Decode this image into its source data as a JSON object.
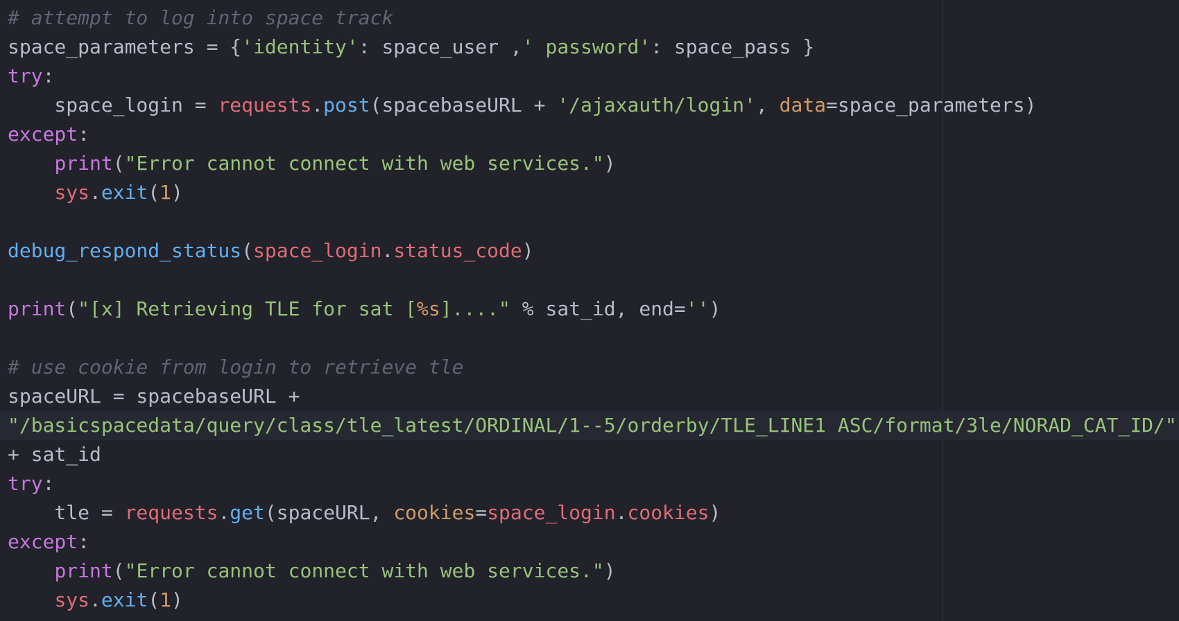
{
  "editor": {
    "theme_colors": {
      "background": "#21222a",
      "comment": "#5f6573",
      "plain": "#b6bdc8",
      "string": "#98c379",
      "keyword": "#c678dd",
      "variable_red": "#e06c75",
      "function_blue": "#61afef",
      "number_orange": "#d19a66"
    },
    "lines": [
      [
        {
          "t": "comment",
          "v": "# attempt to log into space track"
        }
      ],
      [
        {
          "t": "plain",
          "v": "space_parameters = {"
        },
        {
          "t": "string",
          "v": "'identity'"
        },
        {
          "t": "plain",
          "v": ": space_user ,"
        },
        {
          "t": "string",
          "v": "' password'"
        },
        {
          "t": "plain",
          "v": ": space_pass }"
        }
      ],
      [
        {
          "t": "keyword",
          "v": "try"
        },
        {
          "t": "plain",
          "v": ":"
        }
      ],
      [
        {
          "t": "plain",
          "v": "    space_login = "
        },
        {
          "t": "red",
          "v": "requests"
        },
        {
          "t": "plain",
          "v": "."
        },
        {
          "t": "fn",
          "v": "post"
        },
        {
          "t": "plain",
          "v": "(spacebaseURL + "
        },
        {
          "t": "string",
          "v": "'/ajaxauth/login'"
        },
        {
          "t": "plain",
          "v": ", "
        },
        {
          "t": "orange",
          "v": "data"
        },
        {
          "t": "plain",
          "v": "=space_parameters)"
        }
      ],
      [
        {
          "t": "keyword",
          "v": "except"
        },
        {
          "t": "plain",
          "v": ":"
        }
      ],
      [
        {
          "t": "plain",
          "v": "    "
        },
        {
          "t": "keyword",
          "v": "print"
        },
        {
          "t": "plain",
          "v": "("
        },
        {
          "t": "string",
          "v": "\"Error cannot connect with web services.\""
        },
        {
          "t": "plain",
          "v": ")"
        }
      ],
      [
        {
          "t": "plain",
          "v": "    "
        },
        {
          "t": "red",
          "v": "sys"
        },
        {
          "t": "plain",
          "v": "."
        },
        {
          "t": "fn",
          "v": "exit"
        },
        {
          "t": "plain",
          "v": "("
        },
        {
          "t": "orange",
          "v": "1"
        },
        {
          "t": "plain",
          "v": ")"
        }
      ],
      [],
      [
        {
          "t": "fn",
          "v": "debug_respond_status"
        },
        {
          "t": "plain",
          "v": "("
        },
        {
          "t": "red",
          "v": "space_login"
        },
        {
          "t": "plain",
          "v": "."
        },
        {
          "t": "red",
          "v": "status_code"
        },
        {
          "t": "plain",
          "v": ")"
        }
      ],
      [],
      [
        {
          "t": "keyword",
          "v": "print"
        },
        {
          "t": "plain",
          "v": "("
        },
        {
          "t": "string",
          "v": "\"[x] Retrieving TLE for sat ["
        },
        {
          "t": "orange",
          "v": "%s"
        },
        {
          "t": "string",
          "v": "]....\""
        },
        {
          "t": "plain",
          "v": " % sat_id, end="
        },
        {
          "t": "string",
          "v": "''"
        },
        {
          "t": "plain",
          "v": ")"
        }
      ],
      [],
      [
        {
          "t": "comment",
          "v": "# use cookie from login to retrieve tle"
        }
      ],
      [
        {
          "t": "plain",
          "v": "spaceURL = spacebaseURL +"
        }
      ],
      [
        {
          "t": "string",
          "v": "\"/basicspacedata/query/class/tle_latest/ORDINAL/1--5/orderby/TLE_LINE1 ASC/format/3le/NORAD_CAT_ID/\""
        }
      ],
      [
        {
          "t": "plain",
          "v": "+ sat_id"
        }
      ],
      [
        {
          "t": "keyword",
          "v": "try"
        },
        {
          "t": "plain",
          "v": ":"
        }
      ],
      [
        {
          "t": "plain",
          "v": "    tle = "
        },
        {
          "t": "red",
          "v": "requests"
        },
        {
          "t": "plain",
          "v": "."
        },
        {
          "t": "fn",
          "v": "get"
        },
        {
          "t": "plain",
          "v": "(spaceURL, "
        },
        {
          "t": "orange",
          "v": "cookies"
        },
        {
          "t": "plain",
          "v": "="
        },
        {
          "t": "red",
          "v": "space_login"
        },
        {
          "t": "plain",
          "v": "."
        },
        {
          "t": "red",
          "v": "cookies"
        },
        {
          "t": "plain",
          "v": ")"
        }
      ],
      [
        {
          "t": "keyword",
          "v": "except"
        },
        {
          "t": "plain",
          "v": ":"
        }
      ],
      [
        {
          "t": "plain",
          "v": "    "
        },
        {
          "t": "keyword",
          "v": "print"
        },
        {
          "t": "plain",
          "v": "("
        },
        {
          "t": "string",
          "v": "\"Error cannot connect with web services.\""
        },
        {
          "t": "plain",
          "v": ")"
        }
      ],
      [
        {
          "t": "plain",
          "v": "    "
        },
        {
          "t": "red",
          "v": "sys"
        },
        {
          "t": "plain",
          "v": "."
        },
        {
          "t": "fn",
          "v": "exit"
        },
        {
          "t": "plain",
          "v": "("
        },
        {
          "t": "orange",
          "v": "1"
        },
        {
          "t": "plain",
          "v": ")"
        }
      ]
    ],
    "highlighted_line": 14
  }
}
